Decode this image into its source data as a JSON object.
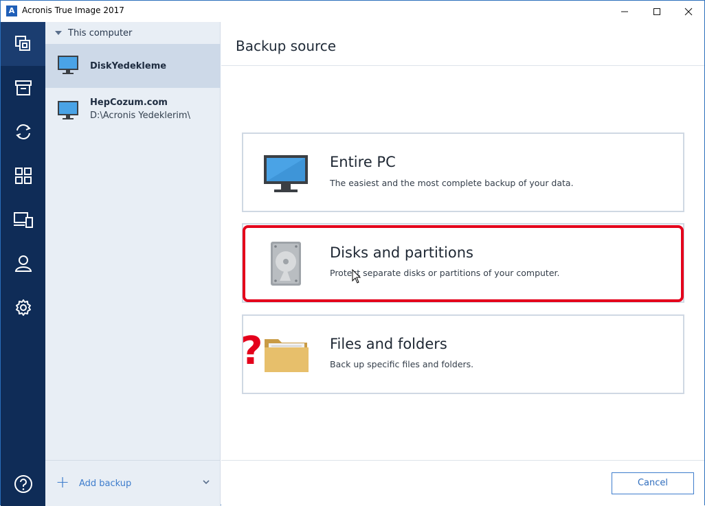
{
  "window": {
    "title": "Acronis True Image 2017",
    "app_icon_letter": "A"
  },
  "rail": {
    "items": [
      {
        "icon": "backup-icon",
        "active": true
      },
      {
        "icon": "archive-icon"
      },
      {
        "icon": "sync-icon"
      },
      {
        "icon": "tools-icon"
      },
      {
        "icon": "devices-icon"
      },
      {
        "icon": "account-icon"
      },
      {
        "icon": "settings-icon"
      }
    ],
    "help_icon": "help-icon"
  },
  "backup_list": {
    "header": "This computer",
    "items": [
      {
        "name": "DiskYedekleme",
        "subtitle": "",
        "selected": true
      },
      {
        "name": "HepCozum.com",
        "subtitle": "D:\\Acronis Yedeklerim\\"
      }
    ],
    "add_backup_label": "Add backup"
  },
  "main": {
    "title": "Backup source",
    "options": [
      {
        "title": "Entire PC",
        "description": "The easiest and the most complete backup of your data.",
        "icon": "monitor-icon"
      },
      {
        "title": "Disks and partitions",
        "description": "Protect separate disks or partitions of your computer.",
        "icon": "hard-disk-icon",
        "highlighted": true
      },
      {
        "title": "Files and folders",
        "description": "Back up specific files and folders.",
        "icon": "folder-icon"
      }
    ],
    "annotation": "?",
    "cancel_label": "Cancel"
  },
  "colors": {
    "rail_bg": "#0f2c57",
    "list_bg": "#e8eef5",
    "accent": "#3d7ccc",
    "highlight": "#e4001b"
  }
}
